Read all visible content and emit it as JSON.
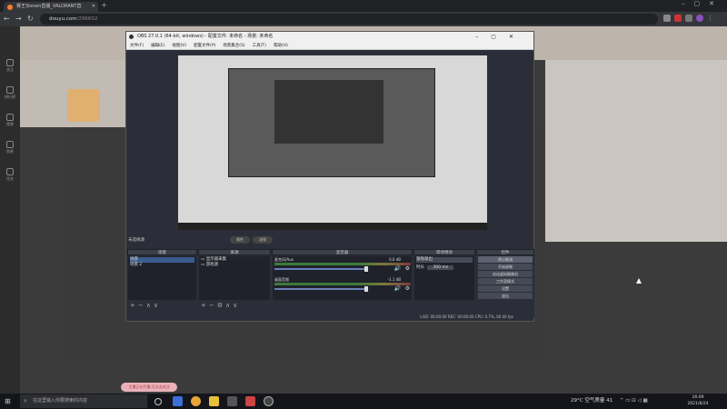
{
  "browser": {
    "tab_title": "赛王Steven直播_VALORANT直",
    "url_host": "douyu.com",
    "url_path": "/296602"
  },
  "sidebar": {
    "items": [
      "关注",
      "排行榜",
      "视频",
      "鱼吧",
      "任务"
    ]
  },
  "obs": {
    "title": "OBS 27.0.1 (64-bit, windows) - 配置文件: 未命名 - 场景: 未命名",
    "menu": [
      "文件(F)",
      "编辑(E)",
      "视图(V)",
      "配置文件(P)",
      "场景集合(S)",
      "工具(T)",
      "帮助(H)"
    ],
    "scene_status": "未选择源",
    "pill_props": "属性",
    "pill_filters": "滤镜",
    "docks": {
      "scenes": {
        "title": "场景",
        "items": [
          "场景",
          "场景 2"
        ]
      },
      "sources": {
        "title": "来源",
        "items": [
          "显示器采集",
          "游戏源"
        ]
      },
      "mixer": {
        "title": "混音器",
        "tracks": [
          {
            "name": "麦克风/Aux",
            "db": "0.0 dB"
          },
          {
            "name": "桌面音频",
            "db": "-1.1 dB"
          }
        ]
      },
      "transitions": {
        "title": "转场特效",
        "type": "渐隐渐出",
        "duration_label": "时长",
        "duration": "300 ms"
      },
      "controls": {
        "title": "控件",
        "buttons": [
          "停止推流",
          "开始录制",
          "启动虚拟摄像机",
          "工作室模式",
          "设置",
          "退出"
        ]
      }
    },
    "statusbar": "LIVE: 00:00:00   REC: 00:00:00   CPU: 0.7%, 60.00 fps"
  },
  "toast": "主播正在开播,可点击关注",
  "taskbar": {
    "search_placeholder": "在这里输入你要搜索的内容",
    "weather": "29°C 空气质量 41",
    "time": "16:09",
    "date": "2021/8/24"
  },
  "colors": {
    "obs_bg": "#2b2e38",
    "accent": "#3a5b8c",
    "douyu_orange": "#ff7a2e"
  }
}
